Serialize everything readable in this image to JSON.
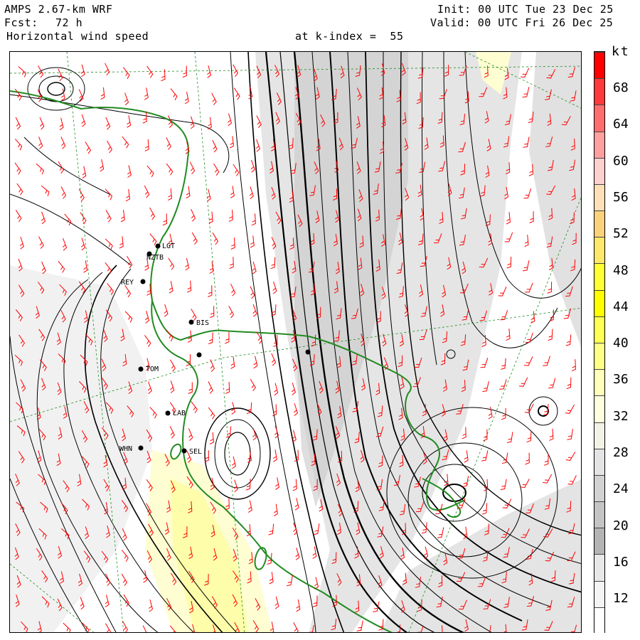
{
  "header": {
    "model": "AMPS 2.67-km WRF",
    "forecast_label": "Fcst:",
    "forecast_hours": "72 h",
    "field": "Horizontal wind speed",
    "level": "at k-index =  55",
    "init": "Init: 00 UTC Tue 23 Dec 25",
    "valid": "Valid: 00 UTC Fri 26 Dec 25"
  },
  "colorbar": {
    "unit": "kt",
    "labels": [
      "68",
      "64",
      "60",
      "56",
      "52",
      "48",
      "44",
      "40",
      "36",
      "32",
      "28",
      "24",
      "20",
      "16",
      "12"
    ],
    "colors": [
      "#ff0000",
      "#ff3a3a",
      "#ff6e6e",
      "#ffa0a0",
      "#ffd0d0",
      "#fde0b8",
      "#fbd27c",
      "#fde86a",
      "#ffff33",
      "#ffff00",
      "#ffff55",
      "#ffff88",
      "#ffffbb",
      "#fefee0",
      "#f2f2e6",
      "#e4e4e4",
      "#d2d2d2",
      "#c4c4c4",
      "#b4b4b4",
      "#e8e8e8",
      "#f4f4f4",
      "#ffffff"
    ]
  },
  "map": {
    "coast_color": "#228b22",
    "barb_color": "#ff0000",
    "streamline_color": "#000000",
    "stations": [
      {
        "id": "stn-lgt",
        "name": "LGT"
      },
      {
        "id": "stn-nztb",
        "name": "NZTB"
      },
      {
        "id": "stn-rey",
        "name": "REY"
      },
      {
        "id": "stn-bis",
        "name": "BIS"
      },
      {
        "id": "stn-tom",
        "name": "TOM"
      },
      {
        "id": "stn-lab",
        "name": "LAB"
      },
      {
        "id": "stn-whn",
        "name": "WHN"
      },
      {
        "id": "stn-sel",
        "name": "SEL"
      }
    ]
  }
}
